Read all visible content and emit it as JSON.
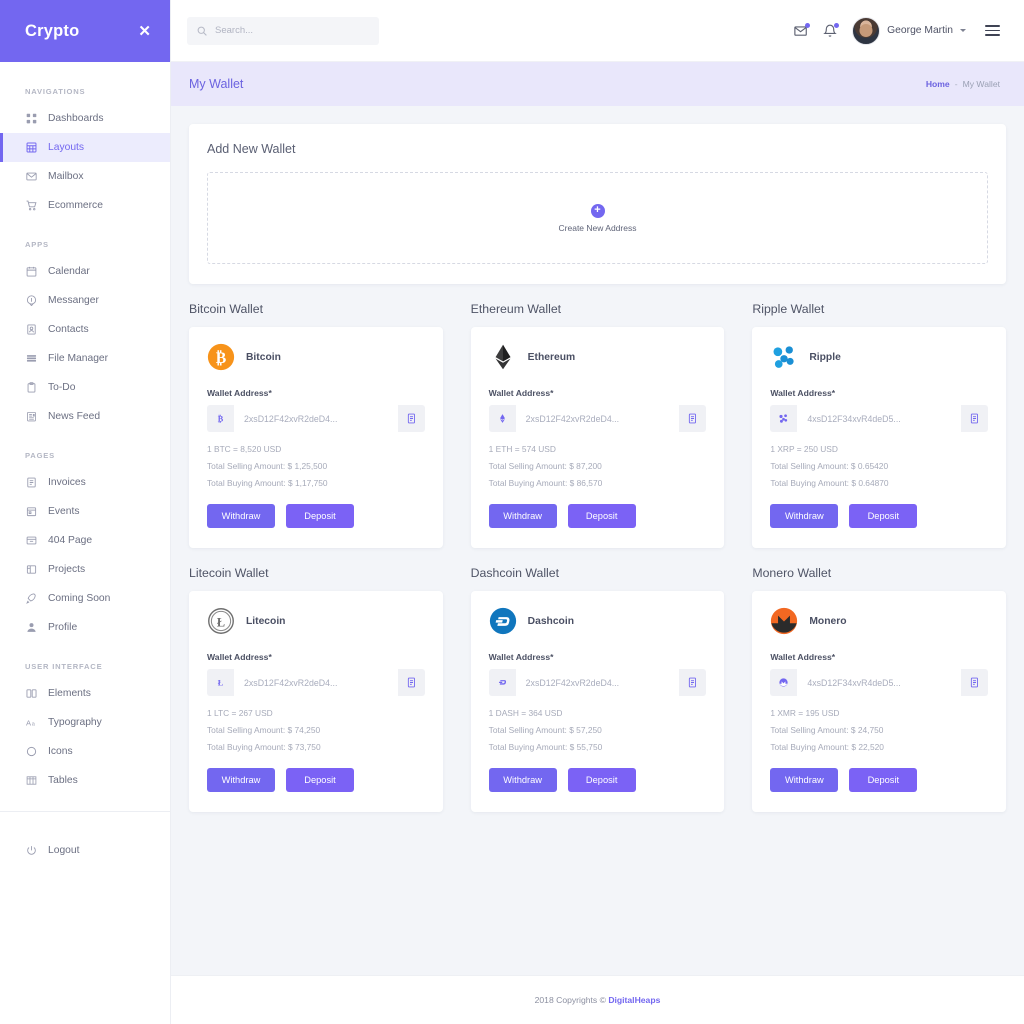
{
  "sidebar": {
    "brand": "Crypto",
    "close_icon": "close-icon",
    "groups": [
      {
        "label": "NAVIGATIONS",
        "items": [
          {
            "label": "Dashboards",
            "icon": "grid-icon",
            "active": false
          },
          {
            "label": "Layouts",
            "icon": "layout-icon",
            "active": true
          },
          {
            "label": "Mailbox",
            "icon": "mail-icon",
            "active": false
          },
          {
            "label": "Ecommerce",
            "icon": "cart-icon",
            "active": false
          }
        ]
      },
      {
        "label": "APPS",
        "items": [
          {
            "label": "Calendar",
            "icon": "calendar-icon",
            "active": false
          },
          {
            "label": "Messanger",
            "icon": "message-icon",
            "active": false
          },
          {
            "label": "Contacts",
            "icon": "contact-icon",
            "active": false
          },
          {
            "label": "File Manager",
            "icon": "folder-icon",
            "active": false
          },
          {
            "label": "To-Do",
            "icon": "clipboard-icon",
            "active": false
          },
          {
            "label": "News Feed",
            "icon": "news-icon",
            "active": false
          }
        ]
      },
      {
        "label": "PAGES",
        "items": [
          {
            "label": "Invoices",
            "icon": "invoice-icon",
            "active": false
          },
          {
            "label": "Events",
            "icon": "events-icon",
            "active": false
          },
          {
            "label": "404 Page",
            "icon": "error-page-icon",
            "active": false
          },
          {
            "label": "Projects",
            "icon": "projects-icon",
            "active": false
          },
          {
            "label": "Coming Soon",
            "icon": "rocket-icon",
            "active": false
          },
          {
            "label": "Profile",
            "icon": "user-icon",
            "active": false
          }
        ]
      },
      {
        "label": "USER INTERFACE",
        "items": [
          {
            "label": "Elements",
            "icon": "elements-icon",
            "active": false
          },
          {
            "label": "Typography",
            "icon": "typography-icon",
            "active": false
          },
          {
            "label": "Icons",
            "icon": "circle-icon",
            "active": false
          },
          {
            "label": "Tables",
            "icon": "table-icon",
            "active": false
          }
        ]
      }
    ],
    "logout": {
      "label": "Logout",
      "icon": "power-icon"
    }
  },
  "topbar": {
    "search": {
      "placeholder": "Search...",
      "value": "",
      "icon": "search-icon"
    },
    "mail_icon": "mail-icon",
    "bell_icon": "bell-icon",
    "user": {
      "name": "George Martin",
      "avatar": "avatar"
    },
    "menu_icon": "hamburger-icon"
  },
  "pagebar": {
    "title": "My Wallet",
    "breadcrumb": {
      "home": "Home",
      "separator": "-",
      "current": "My Wallet"
    }
  },
  "add_wallet": {
    "title": "Add New Wallet",
    "cta_label": "Create New Address",
    "plus_icon": "plus-circle-icon"
  },
  "wallets": [
    {
      "section_title": "Bitcoin Wallet",
      "coin_name": "Bitcoin",
      "logo": "bitcoin-logo",
      "field_label": "Wallet Address*",
      "address_placeholder": "2xsD12F42xvR2deD4...",
      "address_value": "",
      "addon_icon": "bitcoin-icon",
      "copy_icon": "copy-icon",
      "rate": "1 BTC = 8,520 USD",
      "selling": "Total Selling Amount: $ 1,25,500",
      "buying": "Total Buying Amount: $ 1,17,750",
      "withdraw_label": "Withdraw",
      "deposit_label": "Deposit"
    },
    {
      "section_title": "Ethereum Wallet",
      "coin_name": "Ethereum",
      "logo": "ethereum-logo",
      "field_label": "Wallet Address*",
      "address_placeholder": "2xsD12F42xvR2deD4...",
      "address_value": "",
      "addon_icon": "ethereum-icon",
      "copy_icon": "copy-icon",
      "rate": "1 ETH = 574 USD",
      "selling": "Total Selling Amount: $ 87,200",
      "buying": "Total Buying Amount: $ 86,570",
      "withdraw_label": "Withdraw",
      "deposit_label": "Deposit"
    },
    {
      "section_title": "Ripple Wallet",
      "coin_name": "Ripple",
      "logo": "ripple-logo",
      "field_label": "Wallet Address*",
      "address_placeholder": "4xsD12F34xvR4deD5...",
      "address_value": "",
      "addon_icon": "ripple-icon",
      "copy_icon": "copy-icon",
      "rate": "1 XRP = 250 USD",
      "selling": "Total Selling Amount: $ 0.65420",
      "buying": "Total Buying Amount: $ 0.64870",
      "withdraw_label": "Withdraw",
      "deposit_label": "Deposit"
    },
    {
      "section_title": "Litecoin Wallet",
      "coin_name": "Litecoin",
      "logo": "litecoin-logo",
      "field_label": "Wallet Address*",
      "address_placeholder": "2xsD12F42xvR2deD4...",
      "address_value": "",
      "addon_icon": "litecoin-icon",
      "copy_icon": "copy-icon",
      "rate": "1 LTC = 267 USD",
      "selling": "Total Selling Amount: $ 74,250",
      "buying": "Total Buying Amount: $ 73,750",
      "withdraw_label": "Withdraw",
      "deposit_label": "Deposit"
    },
    {
      "section_title": "Dashcoin Wallet",
      "coin_name": "Dashcoin",
      "logo": "dashcoin-logo",
      "field_label": "Wallet Address*",
      "address_placeholder": "2xsD12F42xvR2deD4...",
      "address_value": "",
      "addon_icon": "dashcoin-icon",
      "copy_icon": "copy-icon",
      "rate": "1 DASH = 364 USD",
      "selling": "Total Selling Amount: $ 57,250",
      "buying": "Total Buying Amount: $ 55,750",
      "withdraw_label": "Withdraw",
      "deposit_label": "Deposit"
    },
    {
      "section_title": "Monero Wallet",
      "coin_name": "Monero",
      "logo": "monero-logo",
      "field_label": "Wallet Address*",
      "address_placeholder": "4xsD12F34xvR4deD5...",
      "address_value": "",
      "addon_icon": "monero-icon",
      "copy_icon": "copy-icon",
      "rate": "1 XMR = 195 USD",
      "selling": "Total Selling Amount: $ 24,750",
      "buying": "Total Buying Amount: $ 22,520",
      "withdraw_label": "Withdraw",
      "deposit_label": "Deposit"
    }
  ],
  "footer": {
    "copyright": "2018 Copyrights © ",
    "brand_link": "DigitalHeaps"
  },
  "colors": {
    "accent": "#7367f0",
    "accent_light": "#e9e7fb",
    "page_bg": "#f3f5f9",
    "bitcoin": "#f7931a",
    "ethereum": "#3c3c3d",
    "ripple": "#1fa0e0",
    "litecoin": "#7a7a7a",
    "dashcoin": "#1076bd",
    "monero": "#f26822"
  }
}
